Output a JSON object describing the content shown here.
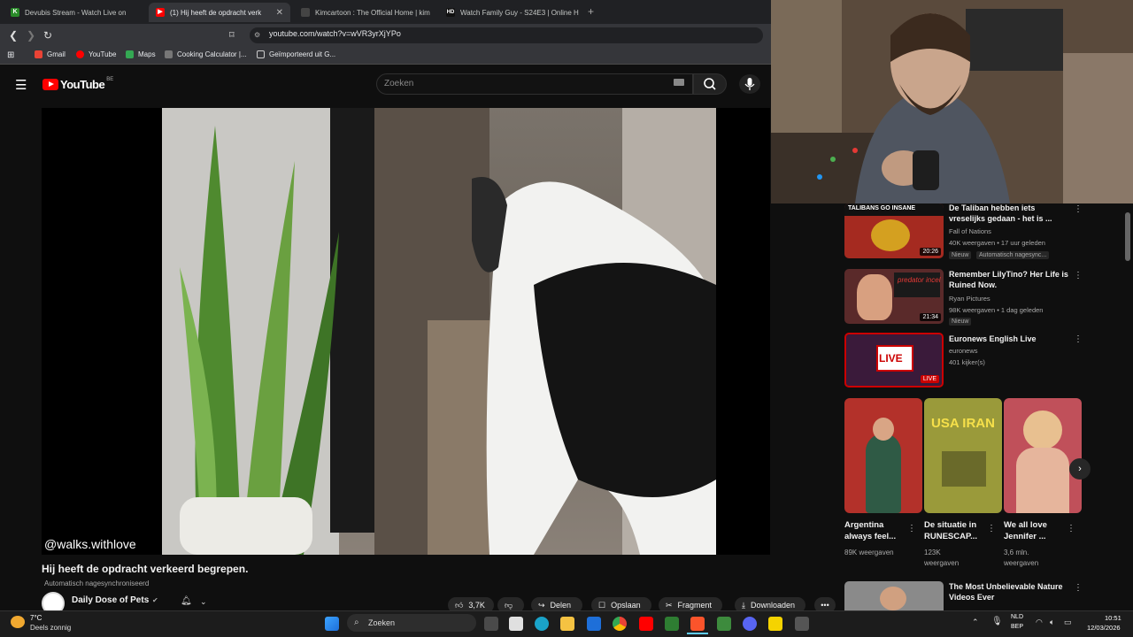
{
  "browser": {
    "tabs": [
      {
        "label": "Devubis Stream - Watch Live on",
        "active": false
      },
      {
        "label": "(1) Hij heeft de opdracht verk",
        "active": true
      },
      {
        "label": "Kimcartoon : The Official Home | kim",
        "active": false
      },
      {
        "label": "Watch Family Guy - S24E3 | Online H",
        "active": false
      }
    ],
    "new_tab": "+",
    "url": "youtube.com/watch?v=wVR3yrXjYPo",
    "bookmarks": [
      "Gmail",
      "YouTube",
      "Maps",
      "Cooking Calculator |...",
      "Geïmporteerd uit G..."
    ]
  },
  "youtube": {
    "logo": "YouTube",
    "region": "BE",
    "search_placeholder": "Zoeken"
  },
  "video": {
    "watermark": "@walks.withlove",
    "title": "Hij heeft de opdracht verkeerd begrepen.",
    "dub_label": "Automatisch nagesynchroniseerd",
    "channel": "Daily Dose of Pets",
    "actions": {
      "like_count": "3,7K",
      "share": "Delen",
      "save": "Opslaan",
      "clip": "Fragment",
      "download": "Downloaden"
    }
  },
  "recommendations": [
    {
      "title": "De Taliban hebben iets vreselijks gedaan - het is ...",
      "channel": "Fall of Nations",
      "meta": "40K weergaven • 17 uur geleden",
      "badges": [
        "Nieuw",
        "Automatisch nagesync..."
      ],
      "duration": "20:26",
      "thumb_text": "TALIBANS GO INSANE"
    },
    {
      "title": "Remember LilyTino? Her Life is Ruined Now.",
      "channel": "Ryan Pictures",
      "meta": "98K weergaven • 1 dag geleden",
      "badges": [
        "Nieuw"
      ],
      "duration": "21:34",
      "thumb_text": "predator incel"
    },
    {
      "title": "Euronews English Live",
      "channel": "euronews",
      "meta": "401 kijker(s)",
      "badges": [],
      "duration": "LIVE",
      "thumb_text": "LIVE"
    },
    {
      "title": "The Most Unbelievable Nature Videos Ever",
      "channel": "",
      "meta": "",
      "badges": [],
      "duration": "",
      "thumb_text": ""
    }
  ],
  "shorts": [
    {
      "title_line1": "Argentina",
      "title_line2": "always feel...",
      "views": "89K weergaven",
      "views_line2": ""
    },
    {
      "title_line1": "De situatie in",
      "title_line2": "RUNESCAP...",
      "views": "123K",
      "views_line2": "weergaven",
      "thumb_text": "USA IRAN"
    },
    {
      "title_line1": "We all love",
      "title_line2": "Jennifer ...",
      "views": "3,6 mln.",
      "views_line2": "weergaven"
    }
  ],
  "taskbar": {
    "weather_temp": "7°C",
    "weather_desc": "Deels zonnig",
    "search_label": "Zoeken",
    "lang_line1": "NLD",
    "lang_line2": "BEP",
    "time": "10:51",
    "date": "12/03/2026"
  },
  "colors": {
    "accent": "#ff0000",
    "bg": "#0f0f0f",
    "live": "#cc0000"
  }
}
